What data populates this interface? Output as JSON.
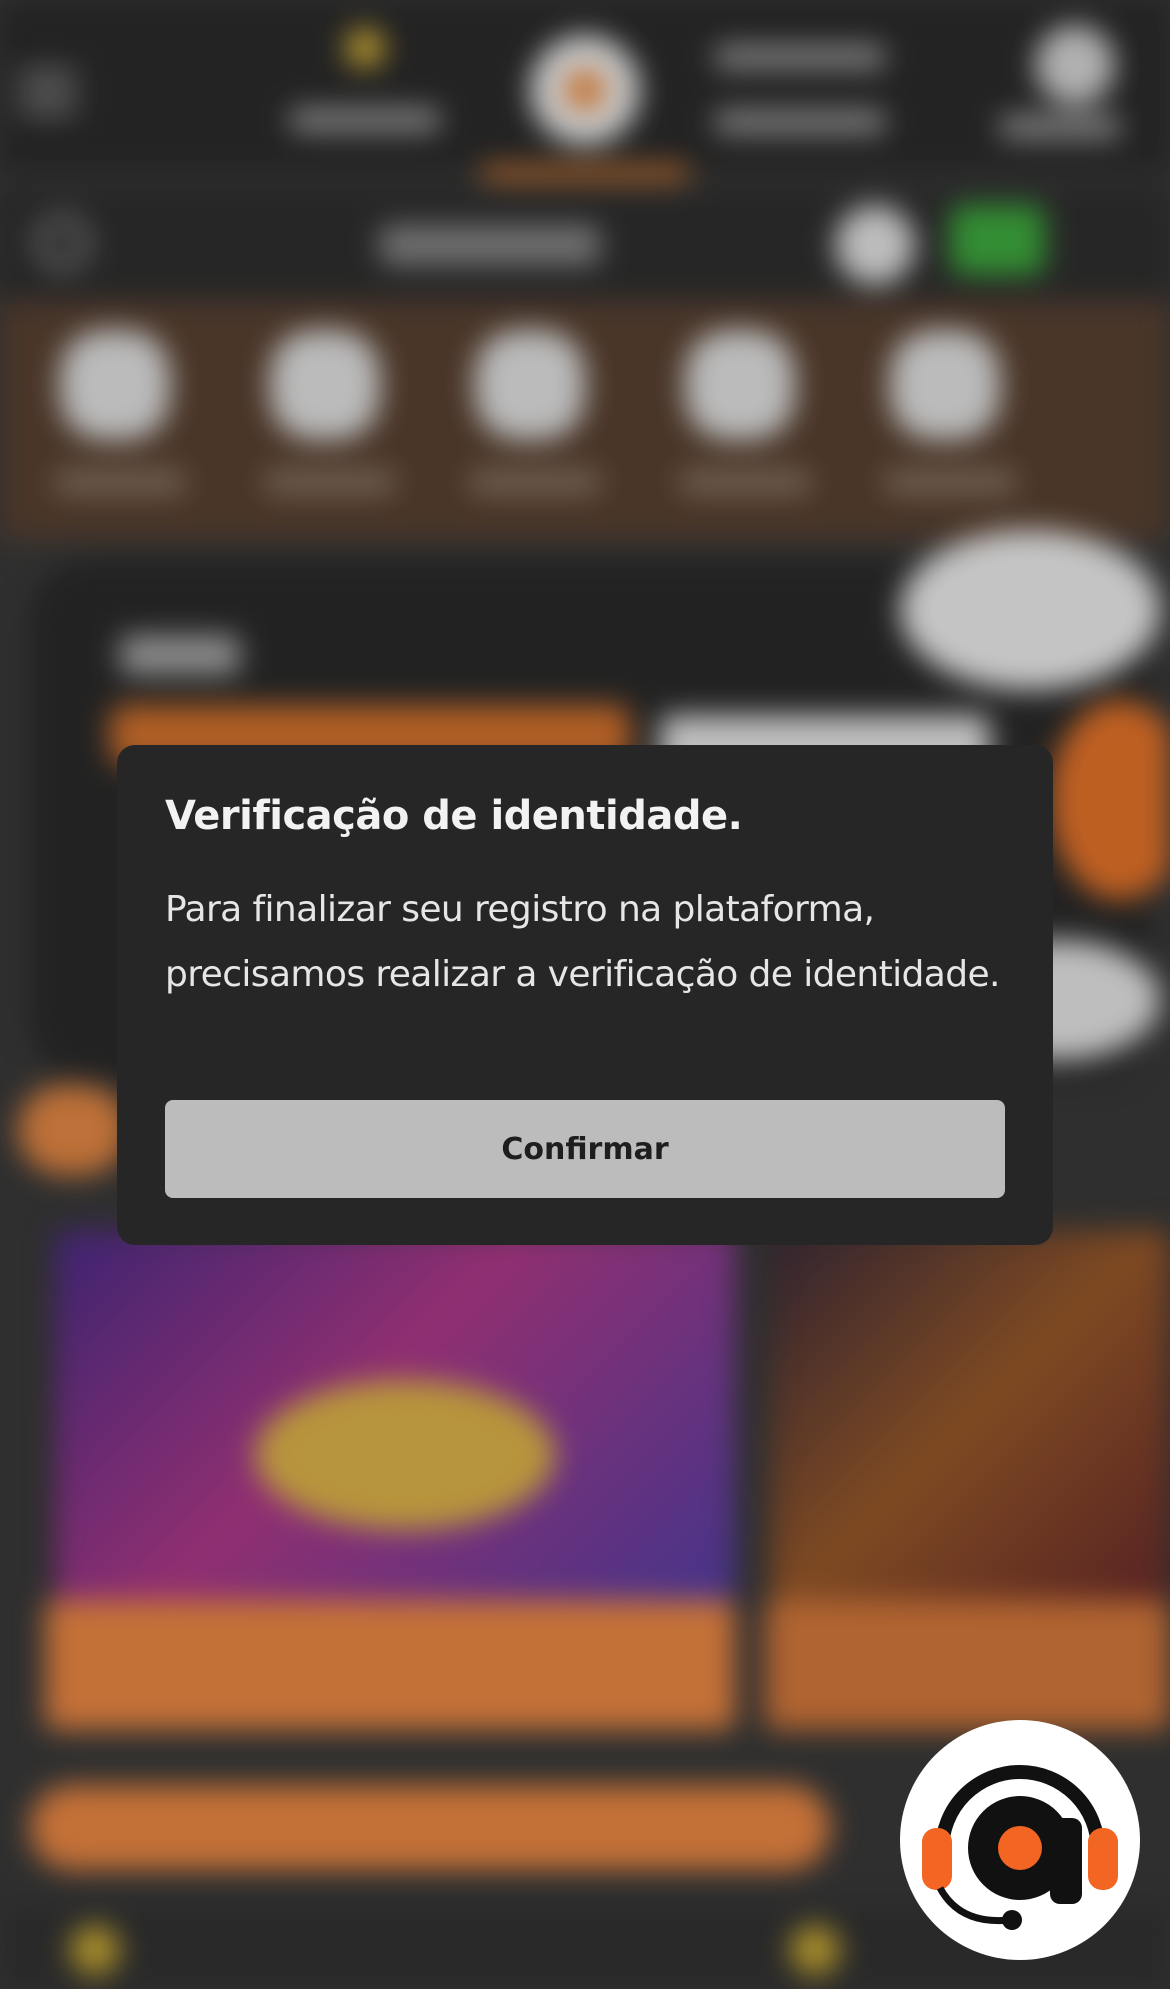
{
  "dialog": {
    "title": "Verificação de identidade.",
    "message": "Para finalizar seu registro na plataforma, precisamos realizar a verificação de identidade.",
    "confirm_label": "Confirmar"
  },
  "support_widget": {
    "icon": "headset-support-icon",
    "colors": {
      "accent": "#f26522",
      "dark": "#111111"
    }
  },
  "theme": {
    "modal_background": "#262626",
    "button_background": "#bcbcbc",
    "brand_orange": "#f08a45"
  }
}
